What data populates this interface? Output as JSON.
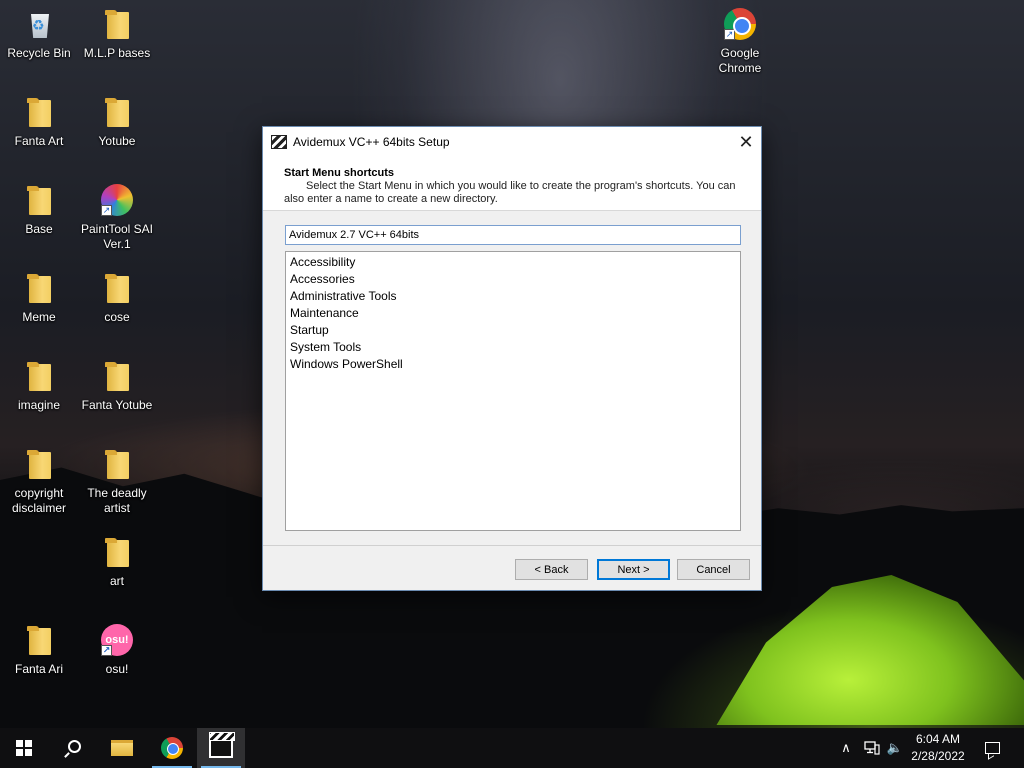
{
  "desktop": {
    "icons": [
      {
        "label": "Recycle Bin",
        "icon": "recycle-bin-icon"
      },
      {
        "label": "M.L.P bases",
        "icon": "folder-icon"
      },
      {
        "label": "Fanta Art",
        "icon": "folder-icon"
      },
      {
        "label": "Yotube",
        "icon": "folder-icon"
      },
      {
        "label": "Base",
        "icon": "folder-icon"
      },
      {
        "label": "PaintTool SAI Ver.1",
        "icon": "painttool-sai-icon"
      },
      {
        "label": "Meme",
        "icon": "folder-icon"
      },
      {
        "label": "cose",
        "icon": "folder-icon"
      },
      {
        "label": "imagine",
        "icon": "folder-icon"
      },
      {
        "label": "Fanta Yotube",
        "icon": "folder-icon"
      },
      {
        "label": "copyright disclaimer",
        "icon": "folder-icon"
      },
      {
        "label": "The deadly artist",
        "icon": "folder-icon"
      },
      {
        "label": "art",
        "icon": "folder-icon"
      },
      {
        "label": "Fanta Ari",
        "icon": "folder-icon"
      },
      {
        "label": "osu!",
        "icon": "osu-icon"
      },
      {
        "label": "Google Chrome",
        "icon": "chrome-icon"
      }
    ],
    "osu_glyph_text": "osu!"
  },
  "dialog": {
    "title": "Avidemux VC++ 64bits Setup",
    "close_symbol": "✕",
    "header_title": "Start Menu shortcuts",
    "header_desc_line1": "Select the Start Menu in which you would like to create the program's shortcuts. You can",
    "header_desc_line2": "also enter a name to create a new directory.",
    "folder_value": "Avidemux 2.7 VC++ 64bits",
    "folders": [
      "Accessibility",
      "Accessories",
      "Administrative Tools",
      "Maintenance",
      "Startup",
      "System Tools",
      "Windows PowerShell"
    ],
    "buttons": {
      "back": "< Back",
      "next": "Next >",
      "cancel": "Cancel"
    }
  },
  "taskbar": {
    "apps": [
      "start-icon",
      "search-icon",
      "file-explorer-icon",
      "chrome-icon",
      "avidemux-icon"
    ],
    "tray": {
      "chevron": "∧",
      "volume": "🔈"
    },
    "time": "6:04 AM",
    "date": "2/28/2022"
  },
  "colors": {
    "accent": "#0078d7",
    "dialog_bg": "#f0f0f0",
    "taskbar_bg": "#101012"
  }
}
